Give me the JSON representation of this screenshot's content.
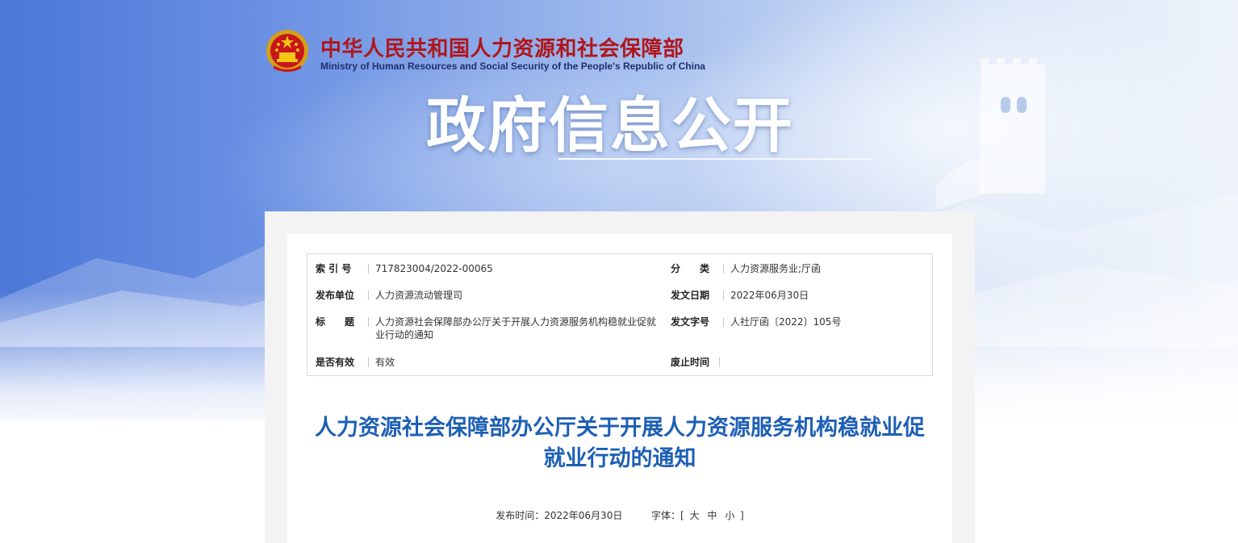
{
  "header": {
    "ministry_cn": "中华人民共和国人力资源和社会保障部",
    "ministry_en": "Ministry of Human Resources and Social Security of the People's Republic of China",
    "banner_title": "政府信息公开",
    "emblem_icon": "national-emblem-icon"
  },
  "meta": {
    "index_label": "索 引 号",
    "index_value": "717823004/2022-00065",
    "category_label": "分　　类",
    "category_value": "人力资源服务业;厅函",
    "publisher_label": "发布单位",
    "publisher_value": "人力资源流动管理司",
    "date_label": "发文日期",
    "date_value": "2022年06月30日",
    "title_label": "标　　题",
    "title_value": "人力资源社会保障部办公厅关于开展人力资源服务机构稳就业促就业行动的通知",
    "docno_label": "发文字号",
    "docno_value": "人社厅函〔2022〕105号",
    "valid_label": "是否有效",
    "valid_value": "有效",
    "abolish_label": "废止时间",
    "abolish_value": ""
  },
  "article": {
    "title": "人力资源社会保障部办公厅关于开展人力资源服务机构稳就业促就业行动的通知",
    "publish_time": "发布时间：2022年06月30日",
    "font_label": "字体：[",
    "font_large": "大",
    "font_medium": "中",
    "font_small": "小",
    "font_close": "]"
  },
  "colors": {
    "ministry_red": "#b0161c",
    "title_blue": "#1d5fb5",
    "banner_blue": "#4b77d8"
  }
}
